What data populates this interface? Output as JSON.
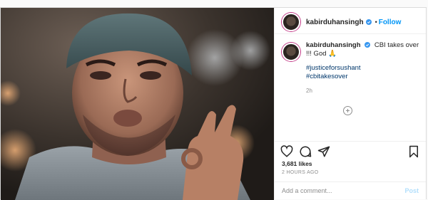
{
  "post": {
    "username": "kabirduhansingh",
    "follow_label": "Follow",
    "dot": "•"
  },
  "caption": {
    "username": "kabirduhansingh",
    "text": "CBI takes over !!! God 🙏",
    "hashtags": [
      "#justiceforsushant",
      "#cbitakesover"
    ],
    "time": "2h"
  },
  "likes": "3,681 likes",
  "post_time": "2 HOURS AGO",
  "comment": {
    "placeholder": "Add a comment...",
    "post_label": "Post"
  },
  "icons": {
    "like": "heart-icon",
    "comment": "comment-icon",
    "share": "share-icon",
    "save": "bookmark-icon",
    "verified": "verified-badge-icon",
    "load_more": "plus-circle-icon"
  },
  "colors": {
    "link": "#0095f6",
    "hashtag": "#00376b",
    "muted": "#8e8e8e",
    "post_disabled": "#b2dffc"
  }
}
